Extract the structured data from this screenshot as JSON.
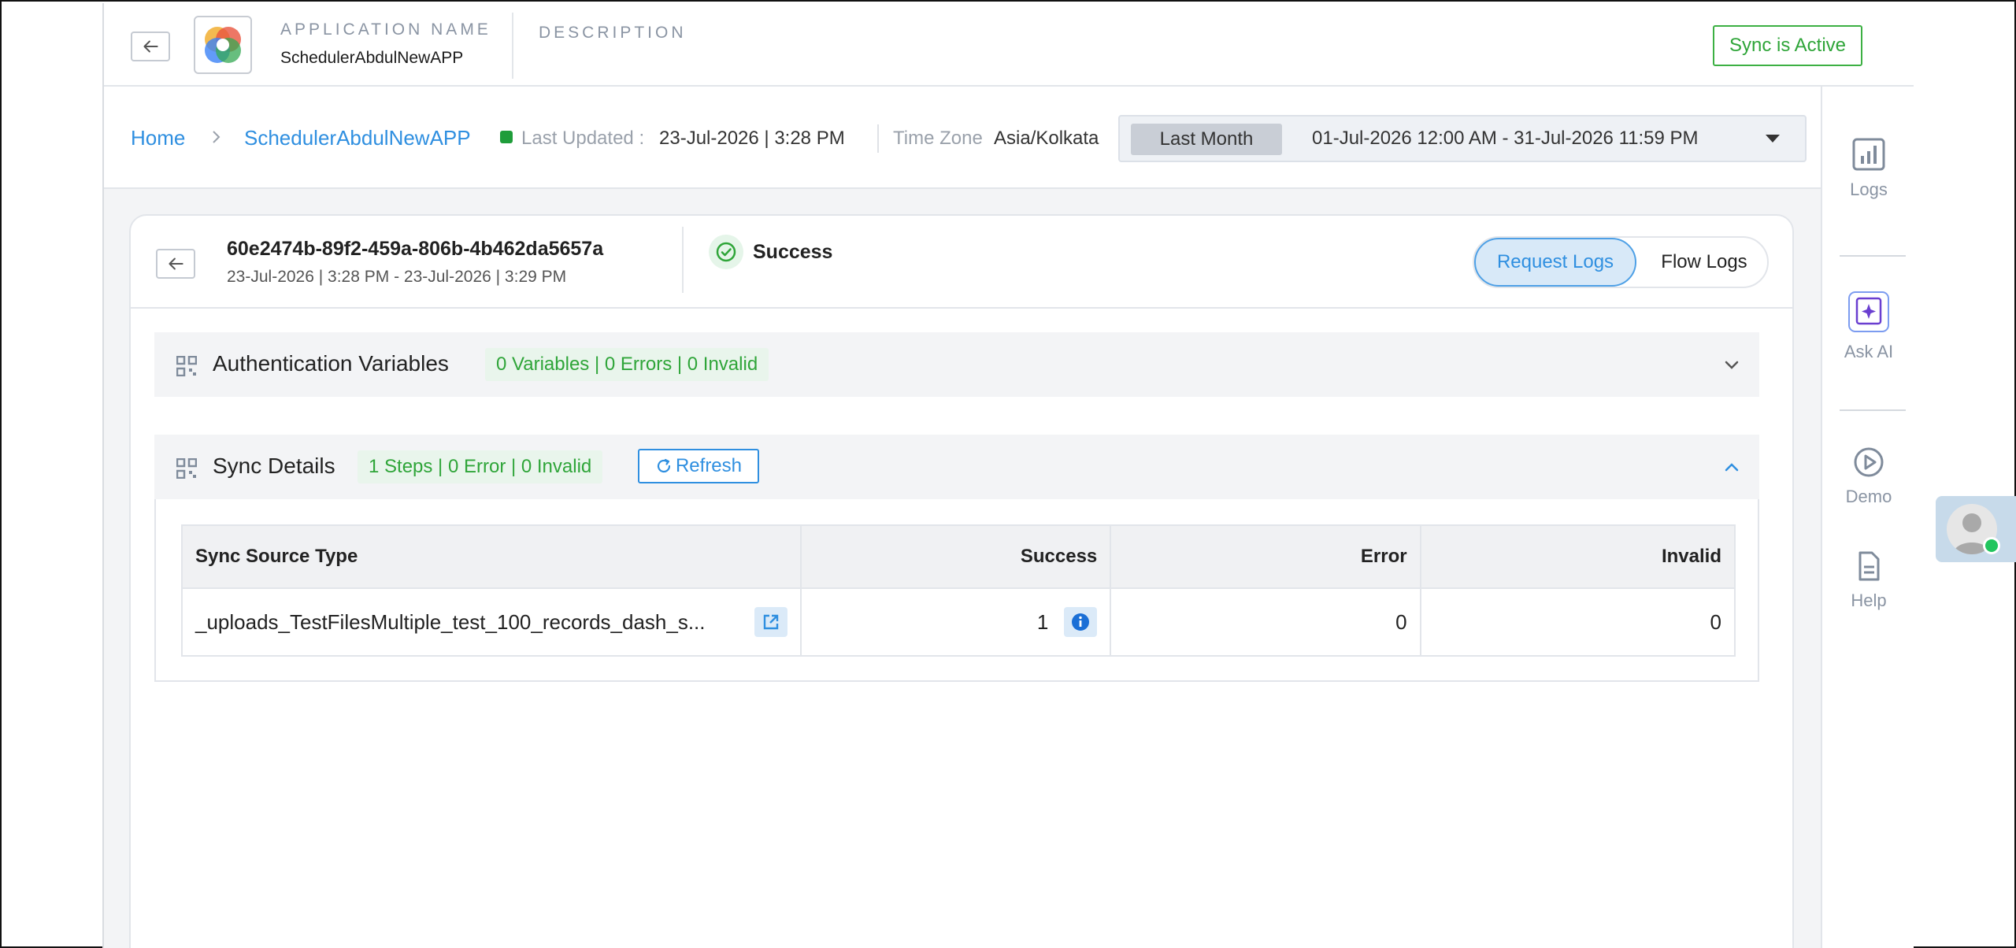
{
  "header": {
    "app_name_label": "APPLICATION NAME",
    "app_name": "SchedulerAbdulNewAPP",
    "description_label": "DESCRIPTION",
    "sync_status": "Sync is Active"
  },
  "breadcrumb": {
    "home": "Home",
    "current": "SchedulerAbdulNewAPP",
    "separator": ">",
    "last_updated_label": "Last Updated :",
    "last_updated_value": "23-Jul-2026 | 3:28 PM",
    "timezone_label": "Time Zone",
    "timezone_value": "Asia/Kolkata"
  },
  "date_filter": {
    "preset": "Last Month",
    "range": "01-Jul-2026 12:00 AM - 31-Jul-2026 11:59 PM"
  },
  "rail": {
    "logs": "Logs",
    "ask_ai": "Ask AI",
    "demo": "Demo",
    "help": "Help"
  },
  "run": {
    "id": "60e2474b-89f2-459a-806b-4b462da5657a",
    "time": "23-Jul-2026 | 3:28 PM - 23-Jul-2026 | 3:29 PM",
    "status": "Success"
  },
  "tabs": {
    "request_logs": "Request Logs",
    "flow_logs": "Flow Logs"
  },
  "auth_section": {
    "title": "Authentication Variables",
    "badge": "0 Variables | 0 Errors | 0 Invalid"
  },
  "sync_section": {
    "title": "Sync Details",
    "badge": "1 Steps | 0 Error | 0 Invalid",
    "refresh": "Refresh",
    "columns": [
      "Sync Source Type",
      "Success",
      "Error",
      "Invalid"
    ],
    "rows": [
      {
        "source": "_uploads_TestFilesMultiple_test_100_records_dash_s...",
        "success": "1",
        "error": "0",
        "invalid": "0"
      }
    ]
  },
  "colors": {
    "accent": "#2f8fe0",
    "success": "#2fa539",
    "muted": "#8a94a3"
  }
}
